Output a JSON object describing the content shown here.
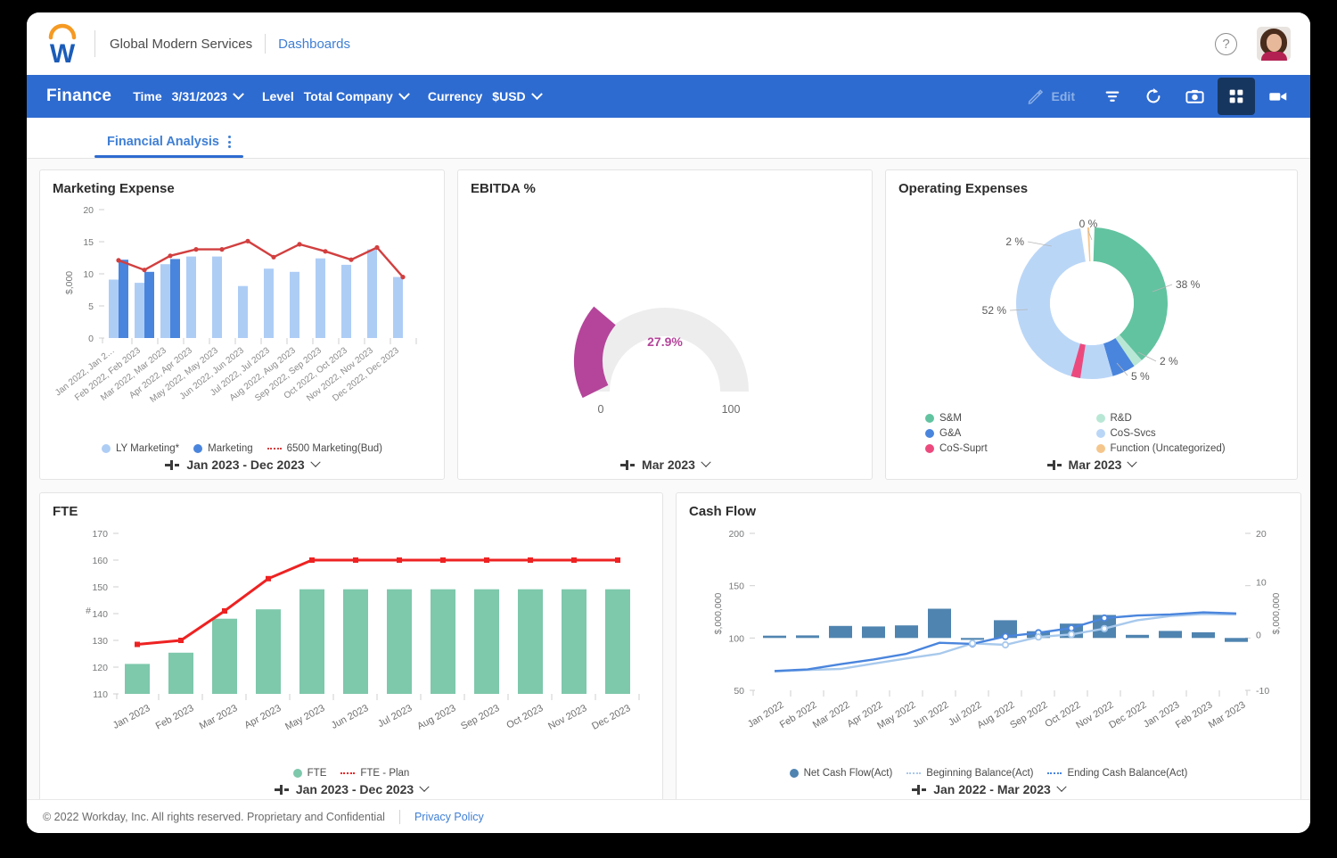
{
  "topbar": {
    "org_name": "Global Modern Services",
    "breadcrumb_link": "Dashboards",
    "help_icon": "help-circle-icon",
    "avatar": "user-avatar"
  },
  "appbar": {
    "title": "Finance",
    "time_label": "Time",
    "time_value": "3/31/2023",
    "level_label": "Level",
    "level_value": "Total Company",
    "currency_label": "Currency",
    "currency_value": "$USD",
    "edit_label": "Edit",
    "icons": [
      "pencil-icon",
      "filter-icon",
      "refresh-icon",
      "camera-icon",
      "grid-icon",
      "video-icon"
    ],
    "accent": "#2e6bd0",
    "active_bg": "#17365f"
  },
  "tabs": [
    {
      "label": "Financial Analysis",
      "active": true
    }
  ],
  "footer": {
    "copyright": "© 2022 Workday, Inc. All rights reserved. Proprietary and Confidential",
    "privacy_link": "Privacy Policy"
  },
  "cards": {
    "marketing": {
      "title": "Marketing Expense",
      "period": "Jan 2023 - Dec 2023"
    },
    "ebitda": {
      "title": "EBITDA %",
      "period": "Mar 2023"
    },
    "opex": {
      "title": "Operating Expenses",
      "period": "Mar 2023"
    },
    "fte": {
      "title": "FTE",
      "period": "Jan 2023 - Dec 2023"
    },
    "cashflow": {
      "title": "Cash Flow",
      "period": "Jan 2022 - Mar 2023"
    }
  },
  "chart_data": [
    {
      "id": "marketing",
      "type": "bar",
      "title": "Marketing Expense",
      "ylabel": "$,000",
      "ylim": [
        0,
        20
      ],
      "yticks": [
        0,
        5,
        10,
        15,
        20
      ],
      "categories": [
        "Jan 2022, Jan 2…",
        "Feb 2022, Feb 2023",
        "Mar 2022, Mar 2023",
        "Apr 2022, Apr 2023",
        "May 2022, May 2023",
        "Jun 2022, Jun 2023",
        "Jul 2022, Jul 2023",
        "Aug 2022, Aug 2023",
        "Sep 2022, Sep 2023",
        "Oct 2022, Oct 2023",
        "Nov 2022, Nov 2023",
        "Dec 2022, Dec 2023"
      ],
      "series": [
        {
          "name": "LY Marketing*",
          "kind": "bar",
          "color": "#aecdf5",
          "values": [
            9.1,
            8.6,
            11.5,
            12.7,
            12.7,
            8.1,
            10.8,
            10.3,
            12.4,
            11.4,
            13.8,
            9.5
          ]
        },
        {
          "name": "Marketing",
          "kind": "bar",
          "color": "#4a85dd",
          "values": [
            12.2,
            10.3,
            12.3,
            null,
            null,
            null,
            null,
            null,
            null,
            null,
            null,
            null
          ]
        },
        {
          "name": "6500 Marketing(Bud)",
          "kind": "line",
          "color": "#d23f3f",
          "values": [
            12.1,
            10.6,
            12.8,
            13.8,
            13.8,
            15.1,
            12.6,
            14.6,
            13.5,
            12.2,
            14.1,
            9.5
          ]
        }
      ],
      "legend_position": "bottom"
    },
    {
      "id": "ebitda",
      "type": "gauge",
      "title": "EBITDA %",
      "value": 27.9,
      "value_label": "27.9%",
      "min": 0,
      "max": 100,
      "min_label": "0",
      "max_label": "100",
      "arc_color": "#b4459a",
      "track_color": "#eeeeee"
    },
    {
      "id": "opex",
      "type": "pie",
      "title": "Operating Expenses",
      "labels": [
        "38 %",
        "2 %",
        "5 %",
        "52 %",
        "2 %",
        "0 %"
      ],
      "categories": [
        "S&M",
        "R&D",
        "G&A",
        "CoS-Svcs",
        "CoS-Suprt",
        "Function (Uncategorized)"
      ],
      "values": [
        38,
        2,
        5,
        52,
        2,
        0.4
      ],
      "colors": [
        "#62c3a0",
        "#b9e7d6",
        "#4a85dd",
        "#bad6f7",
        "#ec4a7e",
        "#f5c68c"
      ],
      "legend": [
        {
          "label": "S&M",
          "color": "#62c3a0"
        },
        {
          "label": "R&D",
          "color": "#b9e7d6"
        },
        {
          "label": "G&A",
          "color": "#4a85dd"
        },
        {
          "label": "CoS-Svcs",
          "color": "#bad6f7"
        },
        {
          "label": "CoS-Suprt",
          "color": "#ec4a7e"
        },
        {
          "label": "Function (Uncategorized)",
          "color": "#f5c68c"
        }
      ],
      "legend_position": "bottom"
    },
    {
      "id": "fte",
      "type": "bar",
      "title": "FTE",
      "ylabel": "#",
      "ylim": [
        110,
        170
      ],
      "yticks": [
        110,
        120,
        130,
        140,
        150,
        160,
        170
      ],
      "categories": [
        "Jan 2023",
        "Feb 2023",
        "Mar 2023",
        "Apr 2023",
        "May 2023",
        "Jun 2023",
        "Jul 2023",
        "Aug 2023",
        "Sep 2023",
        "Oct 2023",
        "Nov 2023",
        "Dec 2023"
      ],
      "series": [
        {
          "name": "FTE",
          "kind": "bar",
          "color": "#7ec8ac",
          "values": [
            121.2,
            125.4,
            138.1,
            141.6,
            149.1,
            149.1,
            149.1,
            149.1,
            149.1,
            149.1,
            149.1,
            149.1
          ]
        },
        {
          "name": "FTE - Plan",
          "kind": "line",
          "color": "#ee2222",
          "values": [
            128.5,
            130.0,
            141.0,
            153.4,
            160.0,
            160.0,
            160.0,
            160.0,
            160.0,
            160.0,
            160.0,
            160.0
          ]
        }
      ],
      "legend_position": "bottom"
    },
    {
      "id": "cashflow",
      "type": "bar",
      "title": "Cash Flow",
      "ylabel": "$,000,000",
      "y2label": "$,000,000",
      "ylim": [
        50,
        200
      ],
      "yticks": [
        50,
        100,
        150,
        200
      ],
      "y2lim": [
        -10,
        20
      ],
      "y2ticks": [
        -10,
        0,
        10,
        20
      ],
      "categories": [
        "Jan 2022",
        "Feb 2022",
        "Mar 2022",
        "Apr 2022",
        "May 2022",
        "Jun 2022",
        "Jul 2022",
        "Aug 2022",
        "Sep 2022",
        "Oct 2022",
        "Nov 2022",
        "Dec 2022",
        "Jan 2023",
        "Feb 2023",
        "Mar 2023"
      ],
      "series": [
        {
          "name": "Net Cash Flow(Act)",
          "kind": "bar",
          "axis": "right",
          "color": "#4f84b0",
          "values": [
            0.45,
            0.5,
            2.3,
            2.2,
            2.4,
            5.6,
            -0.35,
            3.4,
            1.3,
            2.75,
            4.4,
            0.6,
            1.35,
            1.1,
            -0.75
          ]
        },
        {
          "name": "Beginning Balance(Act)",
          "kind": "line",
          "axis": "left",
          "color": "#a8c9ec",
          "values": [
            68,
            69.5,
            70.5,
            75.5,
            80.5,
            85,
            95,
            93.5,
            101,
            103.5,
            109,
            117,
            121,
            123,
            122.5
          ]
        },
        {
          "name": "Ending Cash Balance(Act)",
          "kind": "line",
          "axis": "left",
          "color": "#4a85dd",
          "values": [
            68.5,
            70,
            75,
            79.5,
            85,
            95.5,
            94.5,
            101.5,
            105,
            109.5,
            119,
            121.5,
            122.5,
            124.5,
            123.5
          ]
        }
      ],
      "legend_position": "bottom"
    }
  ]
}
